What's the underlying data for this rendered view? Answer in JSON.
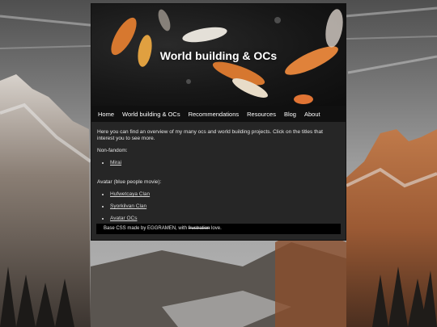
{
  "banner": {
    "title": "World building & OCs"
  },
  "nav": {
    "items": [
      "Home",
      "World building & OCs",
      "Recommendations",
      "Resources",
      "Blog",
      "About"
    ]
  },
  "content": {
    "intro": "Here you can find an overview of my many ocs and world building projects. Click on the titles that interest you to see more.",
    "section1_heading": "Non-fandom:",
    "section1_items": [
      "Mirai"
    ],
    "section2_heading": "Avatar (blue people movie):",
    "section2_items": [
      "Hufwetcaya Clan",
      "Syorkilvan Clan",
      "Avatar OCs"
    ]
  },
  "footer": {
    "prefix": "Base CSS made by EGGRAMEN, with ",
    "strike": "frustration",
    "suffix": " love."
  }
}
